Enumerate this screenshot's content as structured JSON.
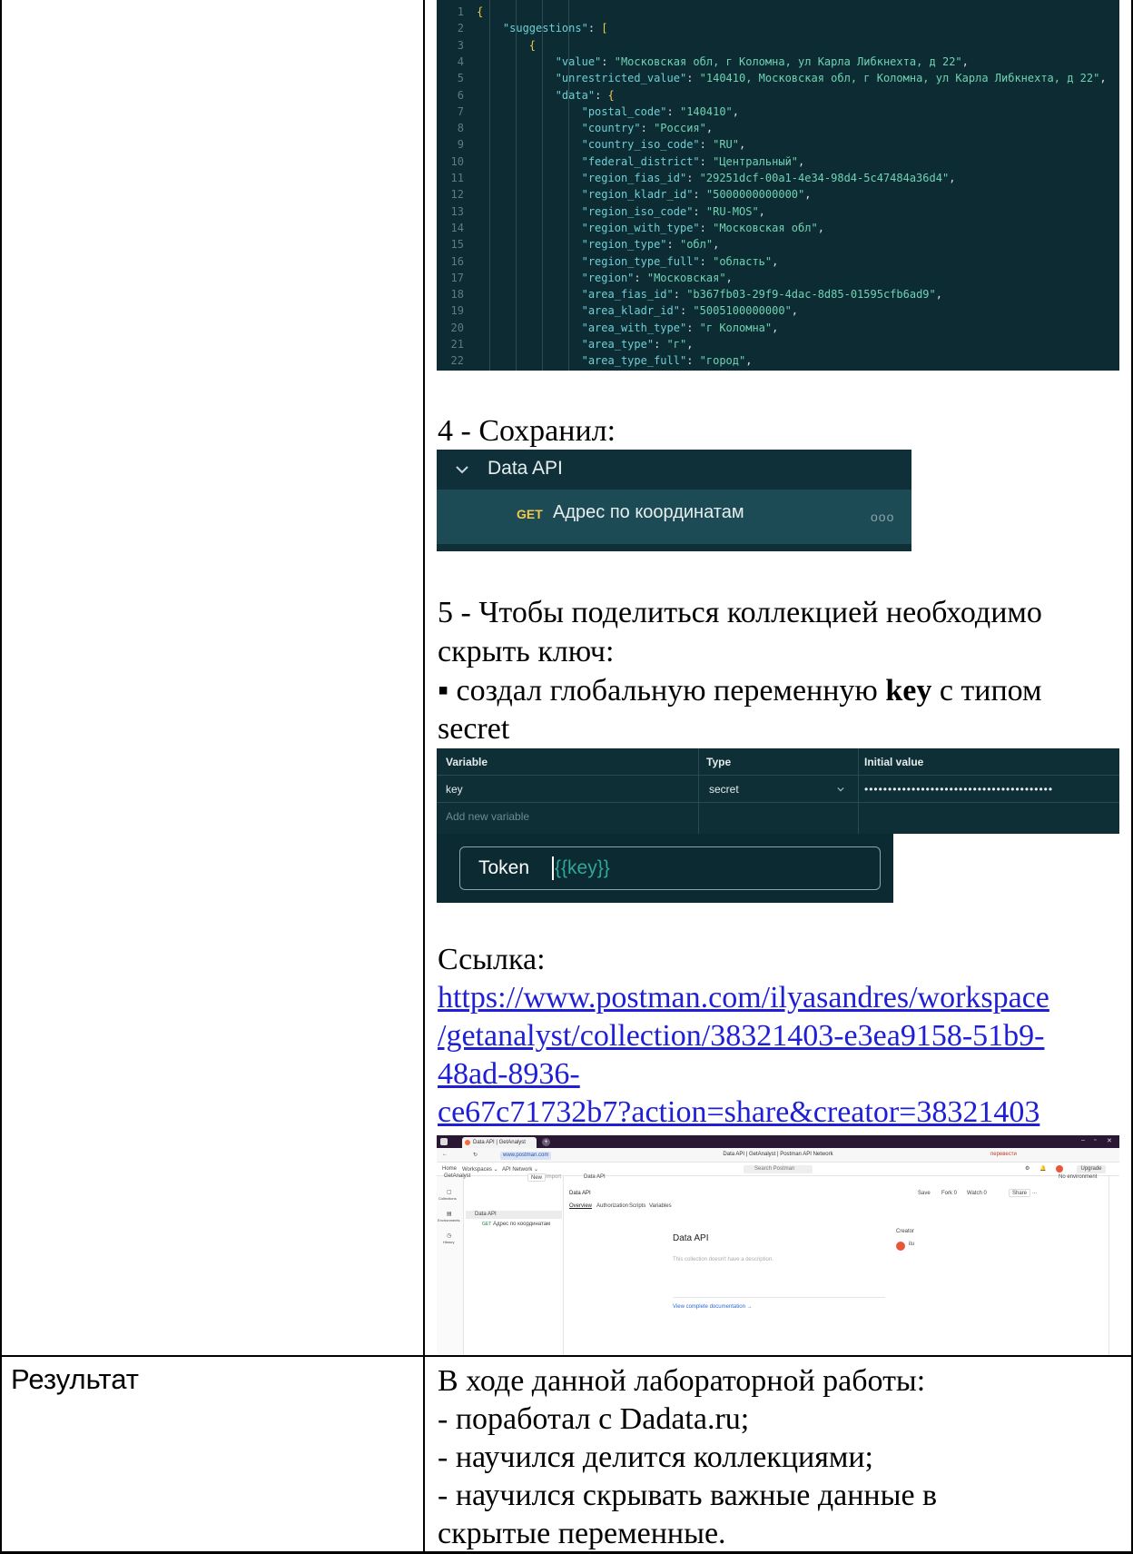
{
  "code": {
    "lines": [
      {
        "n": "1",
        "parts": [
          [
            "bracket",
            "{"
          ]
        ]
      },
      {
        "n": "2",
        "indent": "    ",
        "parts": [
          [
            "k",
            "\"suggestions\""
          ],
          [
            "pn",
            ": "
          ],
          [
            "bracket",
            "["
          ]
        ]
      },
      {
        "n": "3",
        "indent": "        ",
        "parts": [
          [
            "bracket",
            "{"
          ]
        ]
      },
      {
        "n": "4",
        "indent": "            ",
        "parts": [
          [
            "k",
            "\"value\""
          ],
          [
            "pn",
            ": "
          ],
          [
            "s",
            "\"Московская обл, г Коломна, ул Карла Либкнехта, д 22\""
          ],
          [
            "pn",
            ","
          ]
        ]
      },
      {
        "n": "5",
        "indent": "            ",
        "parts": [
          [
            "k",
            "\"unrestricted_value\""
          ],
          [
            "pn",
            ": "
          ],
          [
            "s",
            "\"140410, Московская обл, г Коломна, ул Карла Либкнехта, д 22\""
          ],
          [
            "pn",
            ","
          ]
        ]
      },
      {
        "n": "6",
        "indent": "            ",
        "parts": [
          [
            "k",
            "\"data\""
          ],
          [
            "pn",
            ": "
          ],
          [
            "bracket",
            "{"
          ]
        ]
      },
      {
        "n": "7",
        "indent": "                ",
        "parts": [
          [
            "k",
            "\"postal_code\""
          ],
          [
            "pn",
            ": "
          ],
          [
            "s",
            "\"140410\""
          ],
          [
            "pn",
            ","
          ]
        ]
      },
      {
        "n": "8",
        "indent": "                ",
        "parts": [
          [
            "k",
            "\"country\""
          ],
          [
            "pn",
            ": "
          ],
          [
            "s",
            "\"Россия\""
          ],
          [
            "pn",
            ","
          ]
        ]
      },
      {
        "n": "9",
        "indent": "                ",
        "parts": [
          [
            "k",
            "\"country_iso_code\""
          ],
          [
            "pn",
            ": "
          ],
          [
            "s",
            "\"RU\""
          ],
          [
            "pn",
            ","
          ]
        ]
      },
      {
        "n": "10",
        "indent": "                ",
        "parts": [
          [
            "k",
            "\"federal_district\""
          ],
          [
            "pn",
            ": "
          ],
          [
            "s",
            "\"Центральный\""
          ],
          [
            "pn",
            ","
          ]
        ]
      },
      {
        "n": "11",
        "indent": "                ",
        "parts": [
          [
            "k",
            "\"region_fias_id\""
          ],
          [
            "pn",
            ": "
          ],
          [
            "s",
            "\"29251dcf-00a1-4e34-98d4-5c47484a36d4\""
          ],
          [
            "pn",
            ","
          ]
        ]
      },
      {
        "n": "12",
        "indent": "                ",
        "parts": [
          [
            "k",
            "\"region_kladr_id\""
          ],
          [
            "pn",
            ": "
          ],
          [
            "s",
            "\"5000000000000\""
          ],
          [
            "pn",
            ","
          ]
        ]
      },
      {
        "n": "13",
        "indent": "                ",
        "parts": [
          [
            "k",
            "\"region_iso_code\""
          ],
          [
            "pn",
            ": "
          ],
          [
            "s",
            "\"RU-MOS\""
          ],
          [
            "pn",
            ","
          ]
        ]
      },
      {
        "n": "14",
        "indent": "                ",
        "parts": [
          [
            "k",
            "\"region_with_type\""
          ],
          [
            "pn",
            ": "
          ],
          [
            "s",
            "\"Московская обл\""
          ],
          [
            "pn",
            ","
          ]
        ]
      },
      {
        "n": "15",
        "indent": "                ",
        "parts": [
          [
            "k",
            "\"region_type\""
          ],
          [
            "pn",
            ": "
          ],
          [
            "s",
            "\"обл\""
          ],
          [
            "pn",
            ","
          ]
        ]
      },
      {
        "n": "16",
        "indent": "                ",
        "parts": [
          [
            "k",
            "\"region_type_full\""
          ],
          [
            "pn",
            ": "
          ],
          [
            "s",
            "\"область\""
          ],
          [
            "pn",
            ","
          ]
        ]
      },
      {
        "n": "17",
        "indent": "                ",
        "parts": [
          [
            "k",
            "\"region\""
          ],
          [
            "pn",
            ": "
          ],
          [
            "s",
            "\"Московская\""
          ],
          [
            "pn",
            ","
          ]
        ]
      },
      {
        "n": "18",
        "indent": "                ",
        "parts": [
          [
            "k",
            "\"area_fias_id\""
          ],
          [
            "pn",
            ": "
          ],
          [
            "s",
            "\"b367fb03-29f9-4dac-8d85-01595cfb6ad9\""
          ],
          [
            "pn",
            ","
          ]
        ]
      },
      {
        "n": "19",
        "indent": "                ",
        "parts": [
          [
            "k",
            "\"area_kladr_id\""
          ],
          [
            "pn",
            ": "
          ],
          [
            "s",
            "\"5005100000000\""
          ],
          [
            "pn",
            ","
          ]
        ]
      },
      {
        "n": "20",
        "indent": "                ",
        "parts": [
          [
            "k",
            "\"area_with_type\""
          ],
          [
            "pn",
            ": "
          ],
          [
            "s",
            "\"г Коломна\""
          ],
          [
            "pn",
            ","
          ]
        ]
      },
      {
        "n": "21",
        "indent": "                ",
        "parts": [
          [
            "k",
            "\"area_type\""
          ],
          [
            "pn",
            ": "
          ],
          [
            "s",
            "\"г\""
          ],
          [
            "pn",
            ","
          ]
        ]
      },
      {
        "n": "22",
        "indent": "                ",
        "parts": [
          [
            "k",
            "\"area_type_full\""
          ],
          [
            "pn",
            ": "
          ],
          [
            "s",
            "\"город\""
          ],
          [
            "pn",
            ","
          ]
        ]
      }
    ]
  },
  "step4": {
    "heading": "4 - Сохранил:",
    "collection_name": "Data API",
    "request_method": "GET",
    "request_name": "Адрес по координатам",
    "more": "ooo"
  },
  "step5": {
    "line1": "5 - Чтобы поделиться коллекцией необходимо",
    "line2": "скрыть ключ:",
    "bullet_prefix": "▪ создал глобальную переменную ",
    "bullet_bold": "key",
    "bullet_suffix": " с типом",
    "line4": "secret"
  },
  "variables": {
    "headers": [
      "Variable",
      "Type",
      "Initial value"
    ],
    "row": {
      "variable": "key",
      "type": "secret",
      "initial_value": "••••••••••••••••••••••••••••••••••••••••"
    },
    "add_placeholder": "Add new variable"
  },
  "token": {
    "label": "Token",
    "var": "{{key}}"
  },
  "link": {
    "label": "Ссылка:",
    "lines": [
      "https://www.postman.com/ilyasandres/workspace",
      "/getanalyst/collection/38321403-e3ea9158-51b9-",
      "48ad-8936-",
      "ce67c71732b7?action=share&creator=38321403"
    ]
  },
  "postman": {
    "tab_title": "Data API | GetAnalyst",
    "url_short": "www.postman.com",
    "page_title": "Data API | GetAnalyst | Postman API Network",
    "nav": [
      "Home",
      "Workspaces ⌄",
      "API Network ⌄"
    ],
    "search_placeholder": "Search Postman",
    "upgrade": "Upgrade",
    "translate": "перевести",
    "workspace": "GetAnalyst",
    "btn_new": "New",
    "btn_import": "Import",
    "sidebar": [
      "Collections",
      "Environments",
      "History"
    ],
    "collection": "Data API",
    "request_method": "GET",
    "request": "Адрес по координатам",
    "open_tab": "Data API",
    "env": "No environment",
    "header_title": "Data API",
    "actions": [
      "Save",
      "Fork 0",
      "Watch 0",
      "Share",
      "..."
    ],
    "subtabs": [
      "Overview",
      "Authorization",
      "Scripts",
      "Variables"
    ],
    "overview_title": "Data API",
    "no_desc": "This collection doesn't have a description.",
    "creator_label": "Creator",
    "creator_name": "ilu",
    "doc_link": "View complete documentation →"
  },
  "result": {
    "label": "Результат",
    "lines": [
      "В ходе данной лабораторной работы:",
      "- поработал с Dadata.ru;",
      "- научился делится коллекциями;",
      "- научился скрывать важные данные в",
      "скрытые переменные."
    ]
  }
}
